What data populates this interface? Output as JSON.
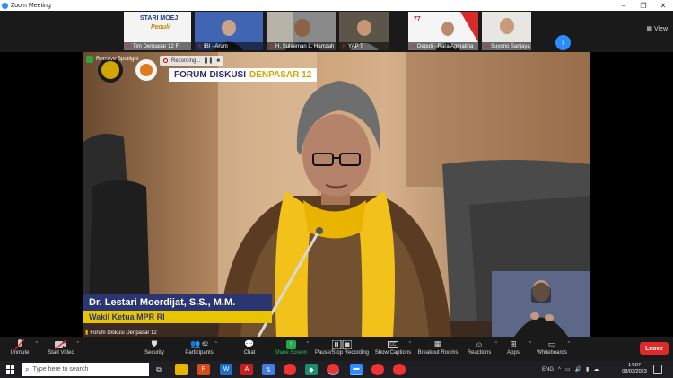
{
  "window": {
    "title": "Zoom Meeting",
    "controls": [
      "–",
      "❐",
      "✕"
    ]
  },
  "view_label": "View",
  "thumbnails": [
    {
      "name": "Tim Denpasar 12 F",
      "logo_line1": "STARI MOEJ",
      "logo_line2": "Peduli"
    },
    {
      "name": "IBI - Arum"
    },
    {
      "name": "H. Sulaeman L. Hamzah"
    },
    {
      "name": "YAP T"
    },
    {
      "name": "Deputi - Rara Agmatina"
    },
    {
      "name": "Suyono Sanjaya"
    }
  ],
  "stage": {
    "spotlight_label": "Remove Spotlight",
    "recording_label": "Recording...",
    "forum_title_a": "FORUM DISKUSI",
    "forum_title_b": "DENPASAR 12",
    "speaker_name": "Dr. Lestari Moerdijat, S.S., M.M.",
    "speaker_role": "Wakil Ketua MPR RI",
    "participant_caption": "Forum Diskusi Denpasar 12"
  },
  "toolbar": {
    "unmute": "Unmute",
    "start_video": "Start Video",
    "security": "Security",
    "participants": "Participants",
    "participants_count": "62",
    "chat": "Chat",
    "share_screen": "Share Screen",
    "pause_recording": "Pause/Stop Recording",
    "show_captions": "Show Captions",
    "breakout_rooms": "Breakout Rooms",
    "reactions": "Reactions",
    "apps": "Apps",
    "whiteboards": "Whiteboards",
    "leave": "Leave"
  },
  "taskbar": {
    "search_placeholder": "Type here to search",
    "language": "ENG",
    "time": "14:07",
    "date": "08/03/2023"
  },
  "colors": {
    "zoom_blue": "#2d8cff",
    "leave_red": "#e02828",
    "nameplate_blue": "#2b3572",
    "nameplate_yellow": "#e8c500",
    "share_green": "#26a84a"
  }
}
